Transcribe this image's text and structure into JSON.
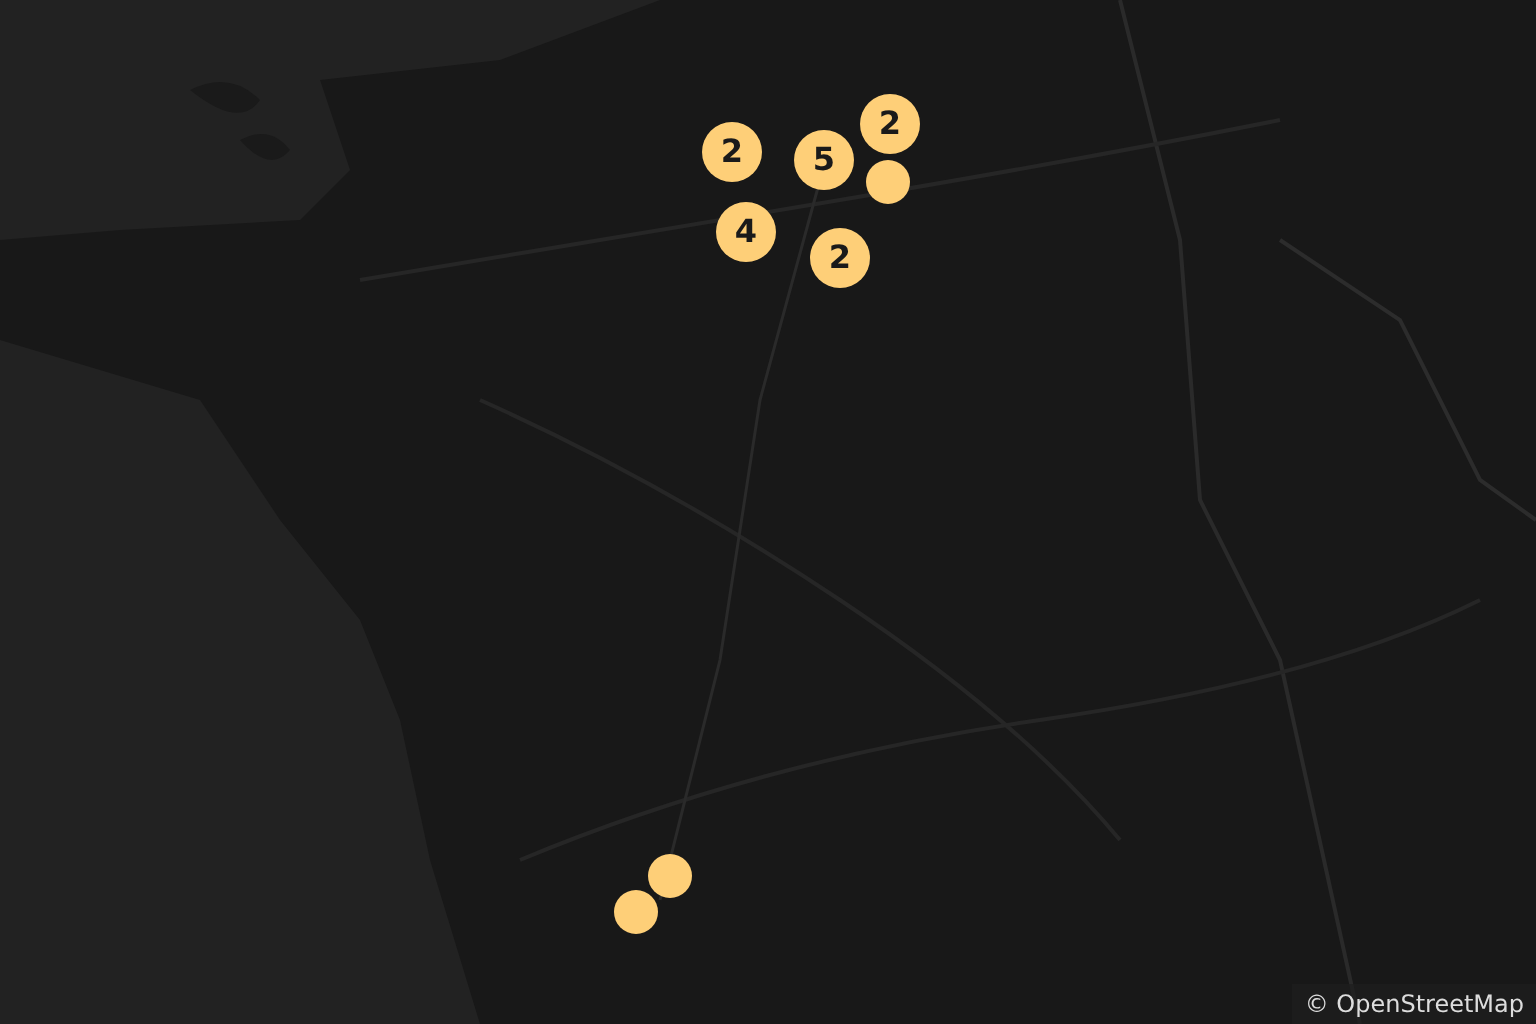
{
  "markers": [
    {
      "kind": "cluster",
      "label": "2"
    },
    {
      "kind": "cluster",
      "label": "5"
    },
    {
      "kind": "cluster",
      "label": "2"
    },
    {
      "kind": "point"
    },
    {
      "kind": "cluster",
      "label": "4"
    },
    {
      "kind": "cluster",
      "label": "2"
    },
    {
      "kind": "point"
    },
    {
      "kind": "point"
    }
  ],
  "attribution": "© OpenStreetMap"
}
